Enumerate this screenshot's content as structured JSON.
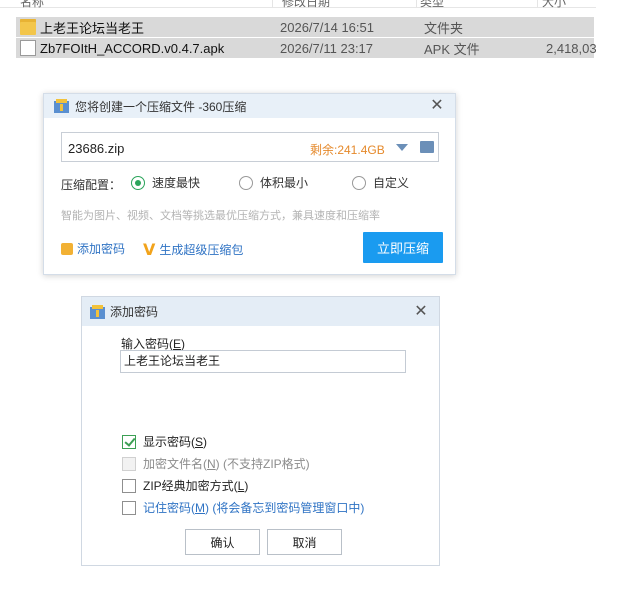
{
  "explorer": {
    "columns": [
      "名称",
      "修改日期",
      "类型",
      "大小"
    ],
    "files": [
      {
        "name": "上老王论坛当老王",
        "date": "2026/7/14 16:51",
        "type": "文件夹",
        "size": "",
        "icon": "folder-icon"
      },
      {
        "name": "Zb7FOItH_ACCORD.v0.4.7.apk",
        "date": "2026/7/11 23:17",
        "type": "APK 文件",
        "size": "2,418,03",
        "icon": "apk-file-icon"
      }
    ]
  },
  "compress_dialog": {
    "title": "您将创建一个压缩文件 -360压缩",
    "filename": "23686.zip",
    "free_space": "剩余:241.4GB",
    "config_label": "压缩配置：",
    "options": [
      {
        "label": "速度最快",
        "selected": true
      },
      {
        "label": "体积最小",
        "selected": false
      },
      {
        "label": "自定义",
        "selected": false
      }
    ],
    "hint": "智能为图片、视频、文档等挑选最优压缩方式，兼具速度和压缩率",
    "add_password": "添加密码",
    "super_pack": "生成超级压缩包",
    "compress_now": "立即压缩",
    "accent_color": "#1a9bf0"
  },
  "password_dialog": {
    "title": "添加密码",
    "input_label_prefix": "输入密码(",
    "input_label_key": "E",
    "input_label_suffix": ")",
    "password_value": "上老王论坛当老王",
    "checkboxes": [
      {
        "pre": "显示密码(",
        "key": "S",
        "post": ")",
        "checked": true,
        "state": "normal"
      },
      {
        "pre": "加密文件名(",
        "key": "N",
        "post": ") (不支持ZIP格式)",
        "checked": false,
        "state": "disabled"
      },
      {
        "pre": "ZIP经典加密方式(",
        "key": "L",
        "post": ")",
        "checked": false,
        "state": "normal"
      },
      {
        "pre": "记住密码(",
        "key": "M",
        "post": ") (将会备忘到密码管理窗口中)",
        "checked": false,
        "state": "blue"
      }
    ],
    "ok": "确认",
    "cancel": "取消"
  }
}
